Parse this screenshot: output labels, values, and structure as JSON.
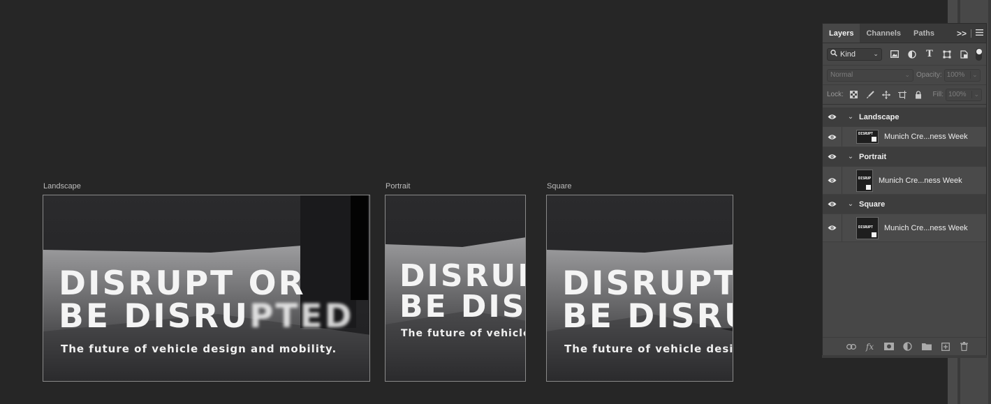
{
  "artboards": [
    {
      "name": "Landscape",
      "headline": [
        "DISRUPT OR",
        "BE DISRU"
      ],
      "headline_blur": "PTED",
      "subline": "The future of vehicle design and mobility."
    },
    {
      "name": "Portrait",
      "headline": [
        "DISRUP",
        "BE DISF"
      ],
      "subline": "The future of vehicle d"
    },
    {
      "name": "Square",
      "headline": [
        "DISRUPT",
        "BE DISRU"
      ],
      "subline": "The future of vehicle desig"
    }
  ],
  "panel": {
    "tabs": [
      {
        "label": "Layers",
        "active": true
      },
      {
        "label": "Channels",
        "active": false
      },
      {
        "label": "Paths",
        "active": false
      }
    ],
    "menu_label": ">>",
    "filter": {
      "label": "Kind"
    },
    "blend_mode": "Normal",
    "opacity_label": "Opacity:",
    "opacity_value": "100%",
    "lock_label": "Lock:",
    "fill_label": "Fill:",
    "fill_value": "100%",
    "groups": [
      {
        "name": "Landscape",
        "layer": {
          "name": "Munich Cre...ness Week",
          "thumb": "DISRUPT"
        }
      },
      {
        "name": "Portrait",
        "layer": {
          "name": "Munich Cre...ness Week",
          "thumb": "DISRUP"
        }
      },
      {
        "name": "Square",
        "layer": {
          "name": "Munich Cre...ness Week",
          "thumb": "DISRUPT"
        }
      }
    ]
  },
  "icons": {
    "tab_menu": "double-chevron-right-icon",
    "hamburger": "hamburger-menu-icon",
    "visibility": "eye-icon",
    "footer": [
      "link-icon",
      "fx-icon",
      "mask-icon",
      "adjustment-icon",
      "folder-icon",
      "new-layer-icon",
      "trash-icon"
    ]
  },
  "colors": {
    "canvas_bg": "#262626",
    "panel_bg": "#474747",
    "panel_active_tab": "#474747",
    "group_row": "#3d3d3d"
  }
}
